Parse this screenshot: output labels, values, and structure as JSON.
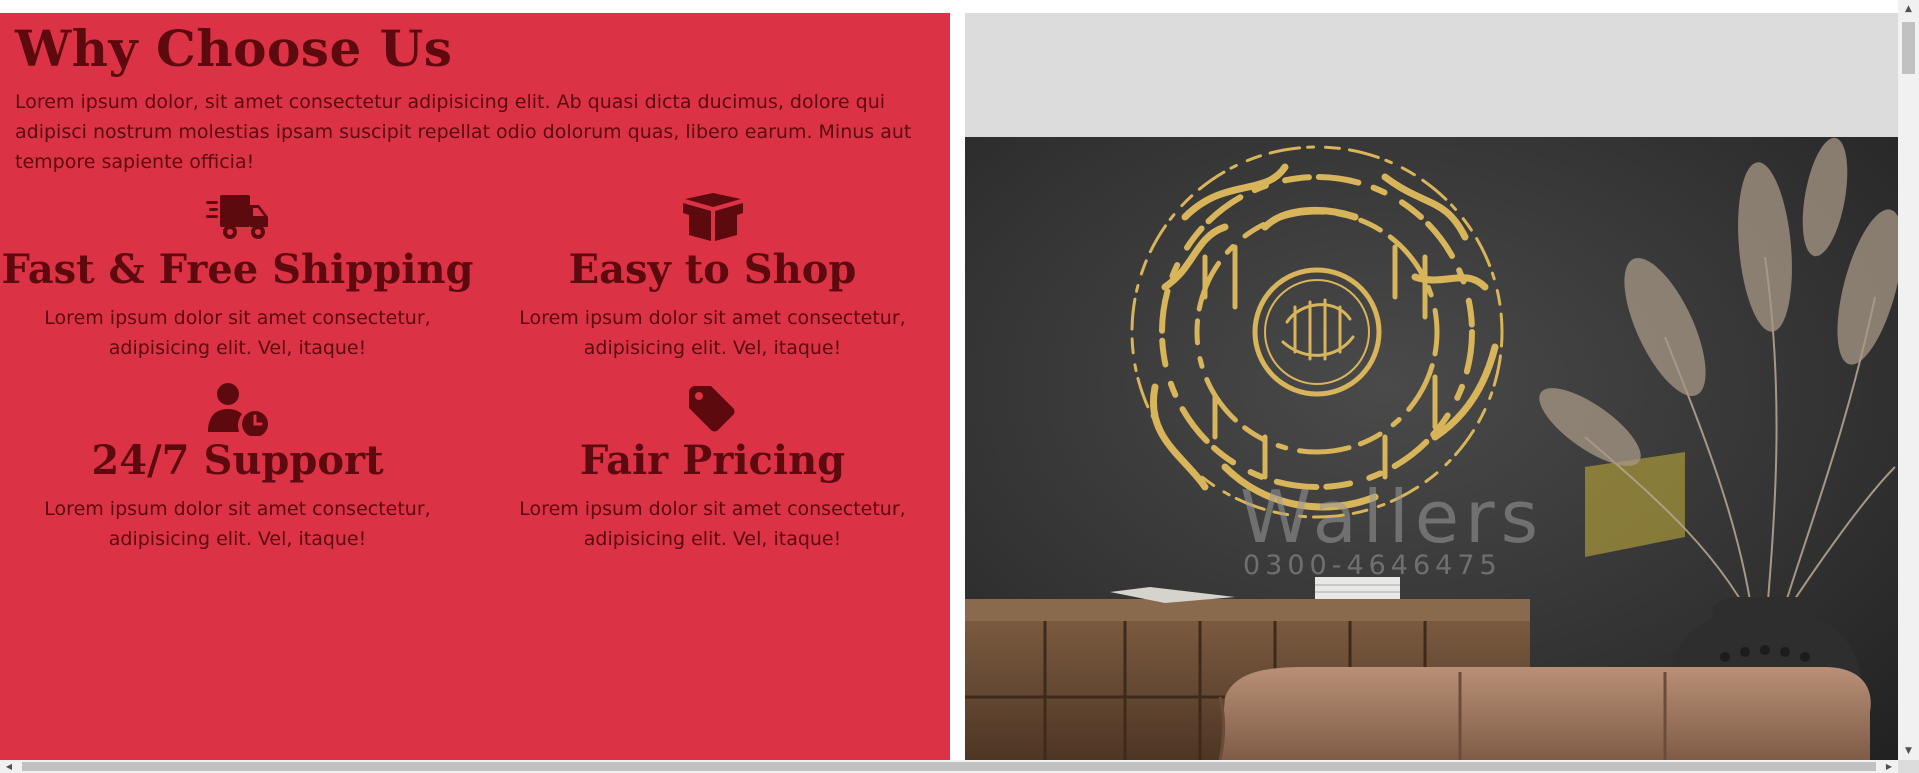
{
  "section": {
    "title": "Why Choose Us",
    "intro": "Lorem ipsum dolor, sit amet consectetur adipisicing elit. Ab quasi dicta ducimus, dolore qui adipisci nostrum molestias ipsam suscipit repellat odio dolorum quas, libero earum. Minus aut tempore sapiente officia!"
  },
  "features": [
    {
      "icon": "shipping-fast-icon",
      "title": "Fast & Free Shipping",
      "description": "Lorem ipsum dolor sit amet consectetur, adipisicing elit. Vel, itaque!"
    },
    {
      "icon": "box-open-icon",
      "title": "Easy to Shop",
      "description": "Lorem ipsum dolor sit amet consectetur, adipisicing elit. Vel, itaque!"
    },
    {
      "icon": "user-clock-icon",
      "title": "24/7 Support",
      "description": "Lorem ipsum dolor sit amet consectetur, adipisicing elit. Vel, itaque!"
    },
    {
      "icon": "tag-icon",
      "title": "Fair Pricing",
      "description": "Lorem ipsum dolor sit amet consectetur, adipisicing elit. Vel, itaque!"
    }
  ],
  "image": {
    "watermark_brand": "Wallers",
    "watermark_phone": "0300-4646475"
  },
  "colors": {
    "panel_background": "#db3246",
    "text_dark_red": "#5c0a0e",
    "image_placeholder": "#dcdcdc"
  },
  "scrollbars": {
    "up_arrow": "▲",
    "down_arrow": "▼",
    "left_arrow": "◀",
    "right_arrow": "▶"
  }
}
